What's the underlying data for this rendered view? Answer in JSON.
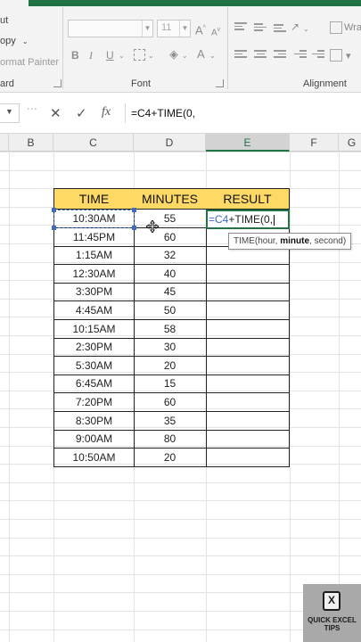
{
  "ribbon": {
    "clipboard": {
      "cut_label": "Cut",
      "copy_label": "Copy",
      "format_painter_label": "Format Painter",
      "group_label": "Clipboard",
      "cut_visible": "ut",
      "copy_visible": "opy",
      "format_painter_visible": "ormat Painter",
      "group_visible": "ard"
    },
    "font": {
      "group_label": "Font",
      "size_value": "11",
      "bold_label": "B",
      "italic_label": "I",
      "underline_label": "U"
    },
    "alignment": {
      "group_label": "Alignment",
      "wrap_text_visible": "Wra"
    }
  },
  "formula_bar": {
    "cancel_symbol": "✕",
    "enter_symbol": "✓",
    "fx_label": "fx",
    "formula": "=C4+TIME(0,"
  },
  "columns": [
    "B",
    "C",
    "D",
    "E",
    "F",
    "G"
  ],
  "active_column": "E",
  "table": {
    "headers": [
      "TIME",
      "MINUTES",
      "RESULT"
    ],
    "header_color": "#ffd966",
    "rows": [
      {
        "time": "10:30AM",
        "minutes": "55"
      },
      {
        "time": "11:45PM",
        "minutes": "60"
      },
      {
        "time": "1:15AM",
        "minutes": "32"
      },
      {
        "time": "12:30AM",
        "minutes": "40"
      },
      {
        "time": "3:30PM",
        "minutes": "45"
      },
      {
        "time": "4:45AM",
        "minutes": "50"
      },
      {
        "time": "10:15AM",
        "minutes": "58"
      },
      {
        "time": "2:30PM",
        "minutes": "30"
      },
      {
        "time": "5:30AM",
        "minutes": "20"
      },
      {
        "time": "6:45AM",
        "minutes": "15"
      },
      {
        "time": "7:20PM",
        "minutes": "60"
      },
      {
        "time": "8:30PM",
        "minutes": "35"
      },
      {
        "time": "9:00AM",
        "minutes": "80"
      },
      {
        "time": "10:50AM",
        "minutes": "20"
      }
    ]
  },
  "editing_cell": {
    "ref_part": "=C4",
    "rest_part": "+TIME(0,"
  },
  "tooltip": {
    "prefix": "TIME(hour, ",
    "current_arg": "minute",
    "suffix": ", second)"
  },
  "logo": {
    "line1": "QUICK EXCEL",
    "line2": "TIPS"
  },
  "colors": {
    "excel_green": "#217346",
    "reference_blue": "#3d6cc0"
  }
}
